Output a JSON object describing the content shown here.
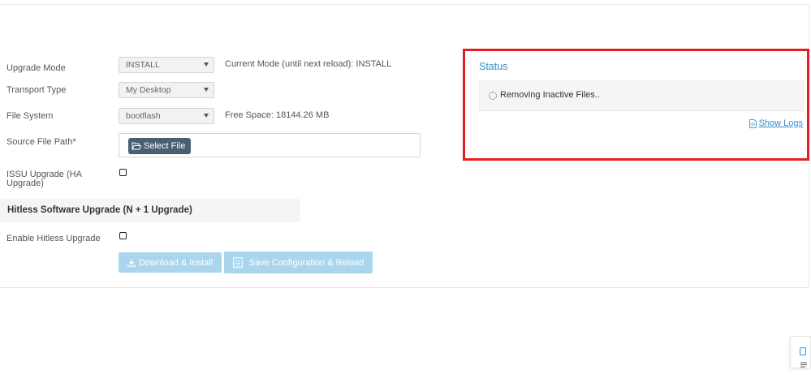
{
  "form": {
    "upgrade_mode": {
      "label": "Upgrade Mode",
      "value": "INSTALL",
      "info": "Current Mode (until next reload): INSTALL"
    },
    "transport_type": {
      "label": "Transport Type",
      "value": "My Desktop"
    },
    "file_system": {
      "label": "File System",
      "value": "bootflash",
      "info": "Free Space: 18144.26 MB"
    },
    "source_file_path": {
      "label": "Source File Path*",
      "button": "Select File"
    },
    "issu_upgrade": {
      "label_line1": "ISSU Upgrade (HA",
      "label_line2": "Upgrade)",
      "checked": false
    }
  },
  "hitless": {
    "section_title": "Hitless Software Upgrade (N + 1 Upgrade)",
    "enable_label": "Enable Hitless Upgrade",
    "checked": false
  },
  "actions": {
    "download_install": "Download & Install",
    "save_reload": "Save Configuration & Reload"
  },
  "status": {
    "title": "Status",
    "message": "Removing Inactive Files..",
    "show_logs": "Show Logs"
  },
  "colors": {
    "accent": "#3190c8",
    "highlight_frame": "#e41d23",
    "button_disabled": "#a9d6ec",
    "file_button": "#4b5f73"
  }
}
